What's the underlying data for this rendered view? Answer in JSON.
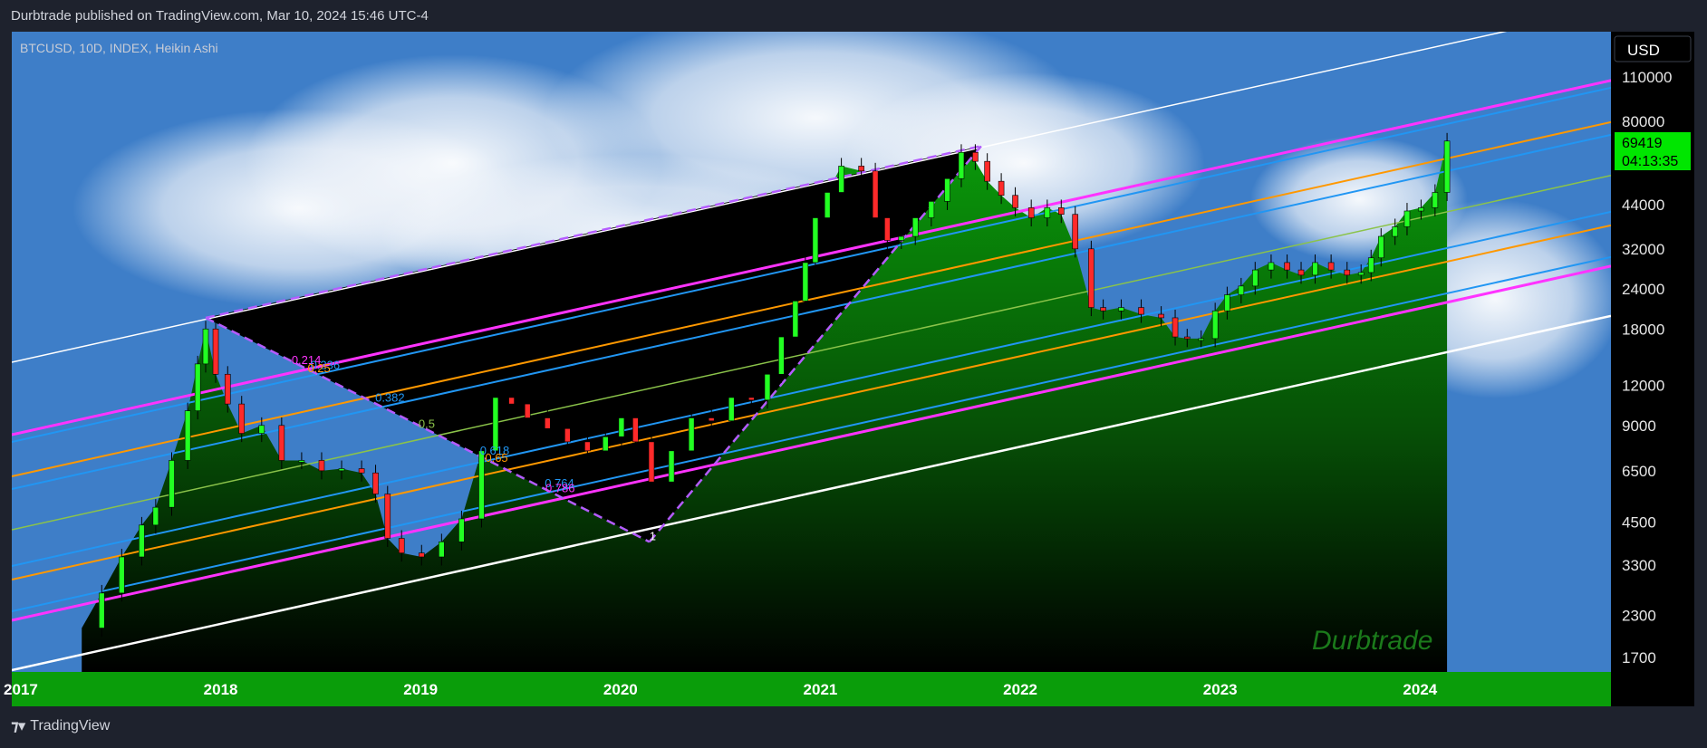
{
  "header": {
    "publish_text": "Durbtrade published on TradingView.com, Mar 10, 2024 15:46 UTC-4"
  },
  "footer": {
    "brand": "TradingView",
    "logo_icon": "tradingview-logo-icon"
  },
  "currency_button": {
    "label": "USD"
  },
  "price_badge": {
    "price": "69419",
    "countdown": "04:13:35",
    "color": "#00e600"
  },
  "watermark": {
    "text": "Durbtrade"
  },
  "colors": {
    "bull": "#22ff22",
    "bear": "#ff2a2a",
    "area": "#0a8a0a",
    "axis_band": "#0a9d0a",
    "sky": "#3e7ec8"
  },
  "chart_data": {
    "type": "candlestick",
    "symbol_label": "BTCUSD, 10D, INDEX, Heikin Ashi",
    "y_scale": "log",
    "x_ticks": [
      "2017",
      "2018",
      "2019",
      "2020",
      "2021",
      "2022",
      "2023",
      "2024"
    ],
    "y_ticks": [
      "110000",
      "80000",
      "44000",
      "32000",
      "24000",
      "18000",
      "12000",
      "9000",
      "6500",
      "4500",
      "3300",
      "2300",
      "1700"
    ],
    "fib_labels": [
      "0.214",
      "0.236",
      "0.25",
      "0.382",
      "0.5",
      "0.618",
      "0.65",
      "0.764",
      "0.786",
      "1"
    ],
    "last_price": 69419,
    "series": [
      {
        "x": [
          2017.35,
          2017.45,
          2017.55,
          2017.65,
          2017.72,
          2017.8,
          2017.88,
          2017.93,
          2017.97,
          2018.02,
          2018.08,
          2018.15,
          2018.25,
          2018.35,
          2018.45,
          2018.55,
          2018.65,
          2018.75,
          2018.82,
          2018.88,
          2018.95,
          2019.05,
          2019.15,
          2019.25,
          2019.35,
          2019.42,
          2019.5,
          2019.58,
          2019.68,
          2019.78,
          2019.88,
          2019.97,
          2020.05,
          2020.12,
          2020.2,
          2020.3,
          2020.4,
          2020.5,
          2020.6,
          2020.7,
          2020.78,
          2020.85,
          2020.92,
          2020.97,
          2021.02,
          2021.08,
          2021.15,
          2021.25,
          2021.32,
          2021.38,
          2021.45,
          2021.52,
          2021.6,
          2021.68,
          2021.75,
          2021.82,
          2021.88,
          2021.95,
          2022.02,
          2022.1,
          2022.18,
          2022.25,
          2022.32,
          2022.4,
          2022.46,
          2022.55,
          2022.65,
          2022.75,
          2022.82,
          2022.88,
          2022.95,
          2023.02,
          2023.08,
          2023.15,
          2023.22,
          2023.3,
          2023.38,
          2023.45,
          2023.52,
          2023.6,
          2023.68,
          2023.75,
          2023.8,
          2023.85,
          2023.92,
          2023.98,
          2024.05,
          2024.12,
          2024.18
        ],
        "close": [
          2100,
          2700,
          3500,
          4400,
          5000,
          7000,
          10000,
          14000,
          18000,
          13000,
          10500,
          8500,
          9000,
          7000,
          7000,
          6500,
          6600,
          6400,
          5500,
          4000,
          3600,
          3500,
          3900,
          4600,
          7500,
          11000,
          10500,
          9500,
          8800,
          8000,
          7500,
          8300,
          9500,
          8000,
          6000,
          7500,
          9500,
          9300,
          11000,
          10800,
          13000,
          17000,
          22000,
          29000,
          40000,
          48000,
          58000,
          56000,
          40000,
          34000,
          35000,
          40000,
          45000,
          53000,
          64000,
          60000,
          52000,
          47000,
          43000,
          40000,
          43000,
          41000,
          32000,
          21000,
          20500,
          21000,
          20000,
          19500,
          17000,
          16800,
          16800,
          20500,
          23000,
          24500,
          27500,
          29000,
          27500,
          26500,
          29000,
          27500,
          26500,
          27000,
          30000,
          35000,
          37500,
          42000,
          43000,
          48000,
          69419
        ]
      }
    ]
  }
}
